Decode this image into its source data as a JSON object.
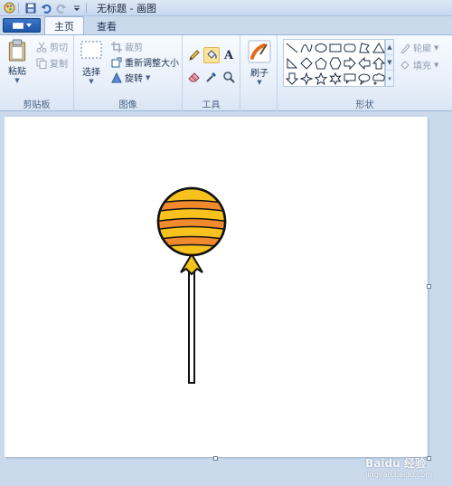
{
  "window": {
    "title": "无标题 - 画图"
  },
  "tabs": [
    {
      "label": "主页"
    },
    {
      "label": "查看"
    }
  ],
  "clipboard": {
    "paste_label": "粘贴",
    "cut_label": "剪切",
    "copy_label": "复制",
    "group_label": "剪贴板"
  },
  "image": {
    "select_label": "选择",
    "crop_label": "裁剪",
    "resize_label": "重新调整大小",
    "rotate_label": "旋转",
    "group_label": "图像"
  },
  "tools": {
    "group_label": "工具"
  },
  "brushes": {
    "label": "刷子"
  },
  "shapes": {
    "outline_label": "轮廓",
    "fill_label": "填充",
    "group_label": "形状"
  },
  "watermark": {
    "brand": "Baidu 经验",
    "url": "jingyan.baidu.com"
  },
  "colors": {
    "balloon_fill": "#f7c21e",
    "balloon_stripe": "#f08a2c",
    "outline": "#111111"
  }
}
